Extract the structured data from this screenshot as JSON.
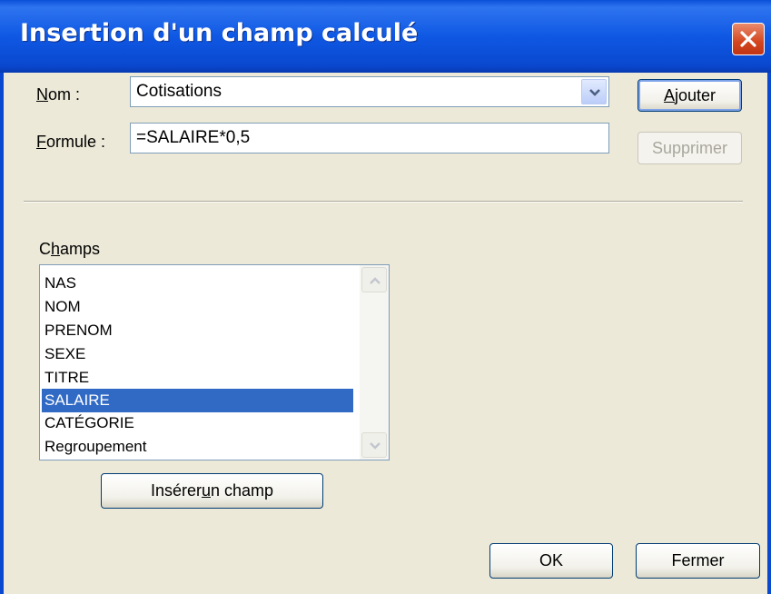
{
  "window": {
    "title": "Insertion d'un champ calculé"
  },
  "nom": {
    "label_accel": "N",
    "label_rest": "om :",
    "value": "Cotisations"
  },
  "formule": {
    "label_accel": "F",
    "label_rest": "ormule :",
    "value": "=SALAIRE*0,5"
  },
  "buttons": {
    "ajouter_accel": "A",
    "ajouter_rest": "jouter",
    "supprimer": "Supprimer",
    "inserer_pre": "Insérer ",
    "inserer_accel": "u",
    "inserer_post": "n champ",
    "ok": "OK",
    "fermer": "Fermer"
  },
  "champs": {
    "label_pre": "C",
    "label_accel": "h",
    "label_post": "amps",
    "items": [
      "NAS",
      "NOM",
      "PRENOM",
      "SEXE",
      "TITRE",
      "SALAIRE",
      "CATÉGORIE",
      "Regroupement"
    ],
    "selected": "SALAIRE"
  },
  "colors": {
    "titlebar": "#0a4fd8",
    "selection": "#316ac5",
    "close": "#d3461e",
    "dialog_bg": "#ece9d8"
  },
  "icons": [
    "close-icon",
    "chevron-down-icon",
    "scroll-up-icon",
    "scroll-down-icon"
  ]
}
